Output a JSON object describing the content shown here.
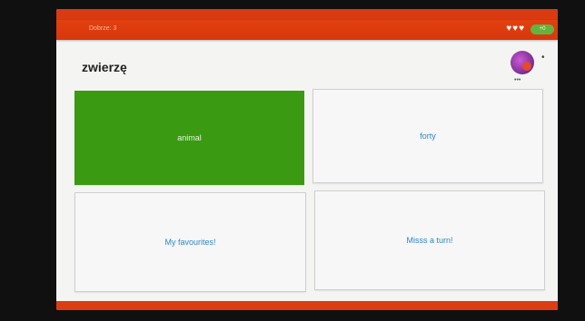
{
  "status_bar": {
    "left_text": "",
    "right_text": ""
  },
  "app_bar": {
    "score_label": "Dobrze: 3",
    "hearts": "♥♥♥",
    "score_pill": "+0"
  },
  "question": {
    "word": "zwierzę"
  },
  "avatar": {
    "dots": "•••",
    "menu": "•"
  },
  "answers": [
    {
      "label": "animal",
      "selected": true
    },
    {
      "label": "forty",
      "selected": false
    },
    {
      "label": "My favourites!",
      "selected": false
    },
    {
      "label": "Misss a turn!",
      "selected": false
    }
  ],
  "colors": {
    "accent": "#d93a12",
    "selected": "#3a9a11",
    "answer_text": "#2f86c6"
  }
}
